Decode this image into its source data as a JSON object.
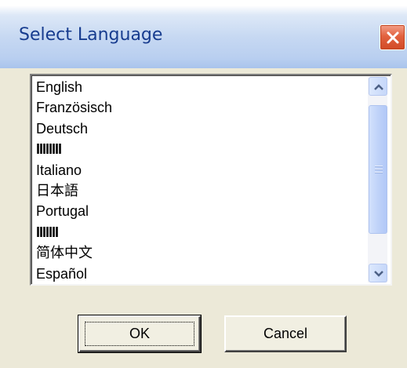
{
  "dialog": {
    "title": "Select Language",
    "close_icon": "close-icon",
    "accent_color": "#173c8f",
    "close_color": "#d14a27"
  },
  "languages": [
    "English",
    "Französisch",
    "Deutsch",
    "IIIIIIII",
    "Italiano",
    "日本語",
    "Portugal",
    "IIIIIII",
    "简体中文",
    "Español"
  ],
  "scrollbar": {
    "up_icon": "chevron-up-icon",
    "down_icon": "chevron-down-icon"
  },
  "buttons": {
    "ok_label": "OK",
    "cancel_label": "Cancel"
  }
}
